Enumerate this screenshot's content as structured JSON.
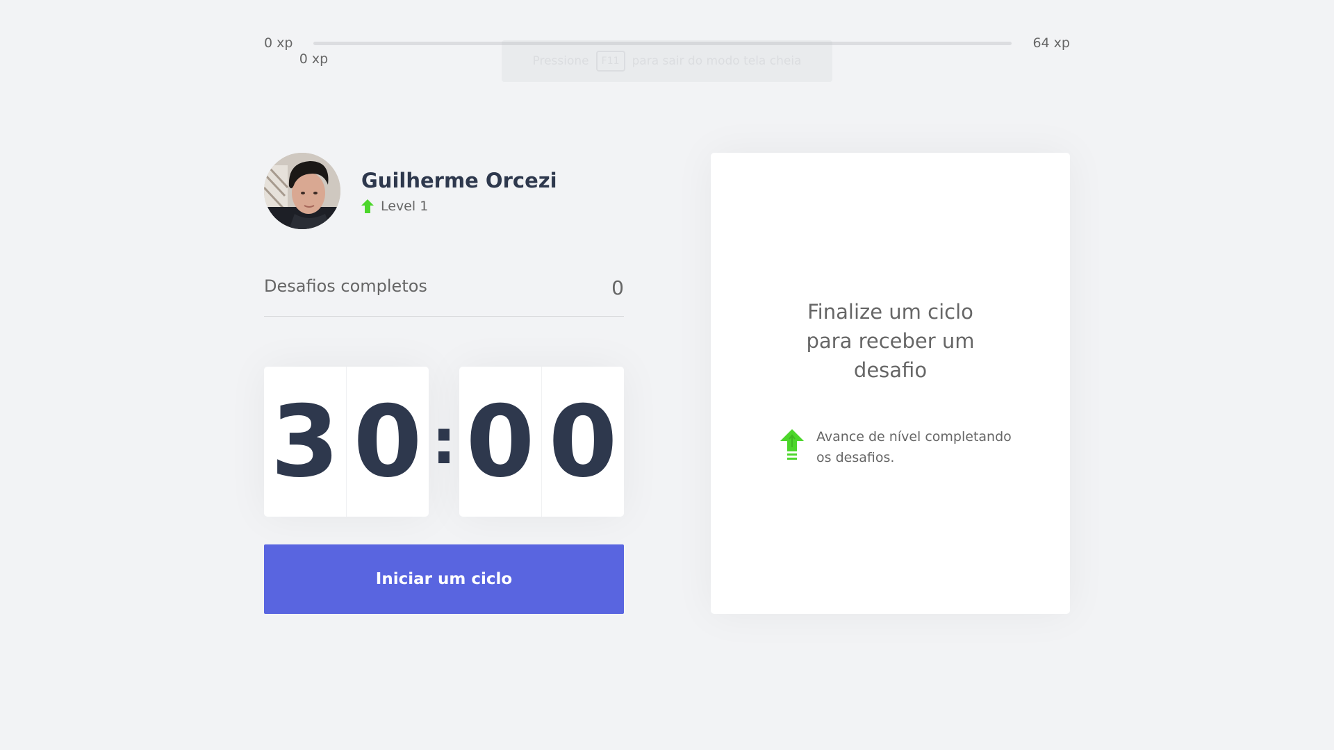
{
  "xp_bar": {
    "min_label": "0 xp",
    "max_label": "64 xp",
    "current_label": "0 xp",
    "progress_fraction": 0
  },
  "fullscreen_hint": {
    "before": "Pressione",
    "key": "F11",
    "after": "para sair do modo tela cheia"
  },
  "profile": {
    "name": "Guilherme Orcezi",
    "level": "Level 1",
    "level_icon": "level-up-arrow-icon"
  },
  "stats": {
    "challenges_label": "Desafios completos",
    "challenges_value": "0"
  },
  "countdown": {
    "minute_left": "3",
    "minute_right": "0",
    "separator": ":",
    "second_left": "0",
    "second_right": "0"
  },
  "actions": {
    "start_cycle_label": "Iniciar um ciclo"
  },
  "challenge_box": {
    "title": "Finalize um ciclo para receber um desafio",
    "hint_text": "Avance de nível completando os desafios.",
    "hint_icon": "level-up-icon"
  },
  "colors": {
    "background": "#f2f3f5",
    "primary": "#5965e0",
    "title": "#2e384d",
    "text": "#666666",
    "green": "#4cd62b",
    "white": "#ffffff"
  }
}
